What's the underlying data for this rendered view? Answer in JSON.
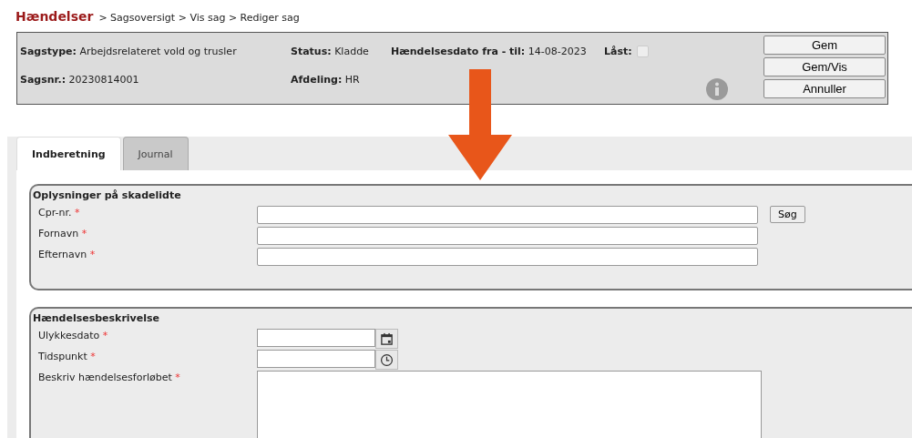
{
  "breadcrumb": {
    "title": "Hændelser",
    "path": "> Sagsoversigt > Vis sag > Rediger sag"
  },
  "header": {
    "info": [
      {
        "label": "Sagstype:",
        "value": "Arbejdsrelateret vold og trusler"
      },
      {
        "label": "Status:",
        "value": "Kladde"
      },
      {
        "label": "Hændelsesdato fra - til:",
        "value": "14-08-2023"
      },
      {
        "label": "Sagsnr.:",
        "value": "20230814001"
      },
      {
        "label": "Afdeling:",
        "value": "HR"
      }
    ],
    "locked": {
      "label": "Låst:",
      "checked": false
    },
    "buttons": [
      "Gem",
      "Gem/Vis",
      "Annuller"
    ]
  },
  "tabs": [
    {
      "label": "Indberetning",
      "selected": true
    },
    {
      "label": "Journal",
      "selected": false
    }
  ],
  "sections": [
    {
      "title": "Oplysninger på skadelidte",
      "fields": [
        {
          "label": "Cpr-nr.",
          "required_mark": "*",
          "kind": "text",
          "button": "Søg"
        },
        {
          "label": "Fornavn",
          "required_mark": "*",
          "kind": "text"
        },
        {
          "label": "Efternavn",
          "required_mark": "*",
          "kind": "text"
        }
      ]
    },
    {
      "title": "Hændelsesbeskrivelse",
      "fields": [
        {
          "label": "Ulykkesdato",
          "required_mark": "*",
          "kind": "date"
        },
        {
          "label": "Tidspunkt",
          "required_mark": "*",
          "kind": "time"
        },
        {
          "label": "Beskriv hændelsesforløbet",
          "required_mark": "*",
          "kind": "textarea"
        }
      ]
    }
  ]
}
